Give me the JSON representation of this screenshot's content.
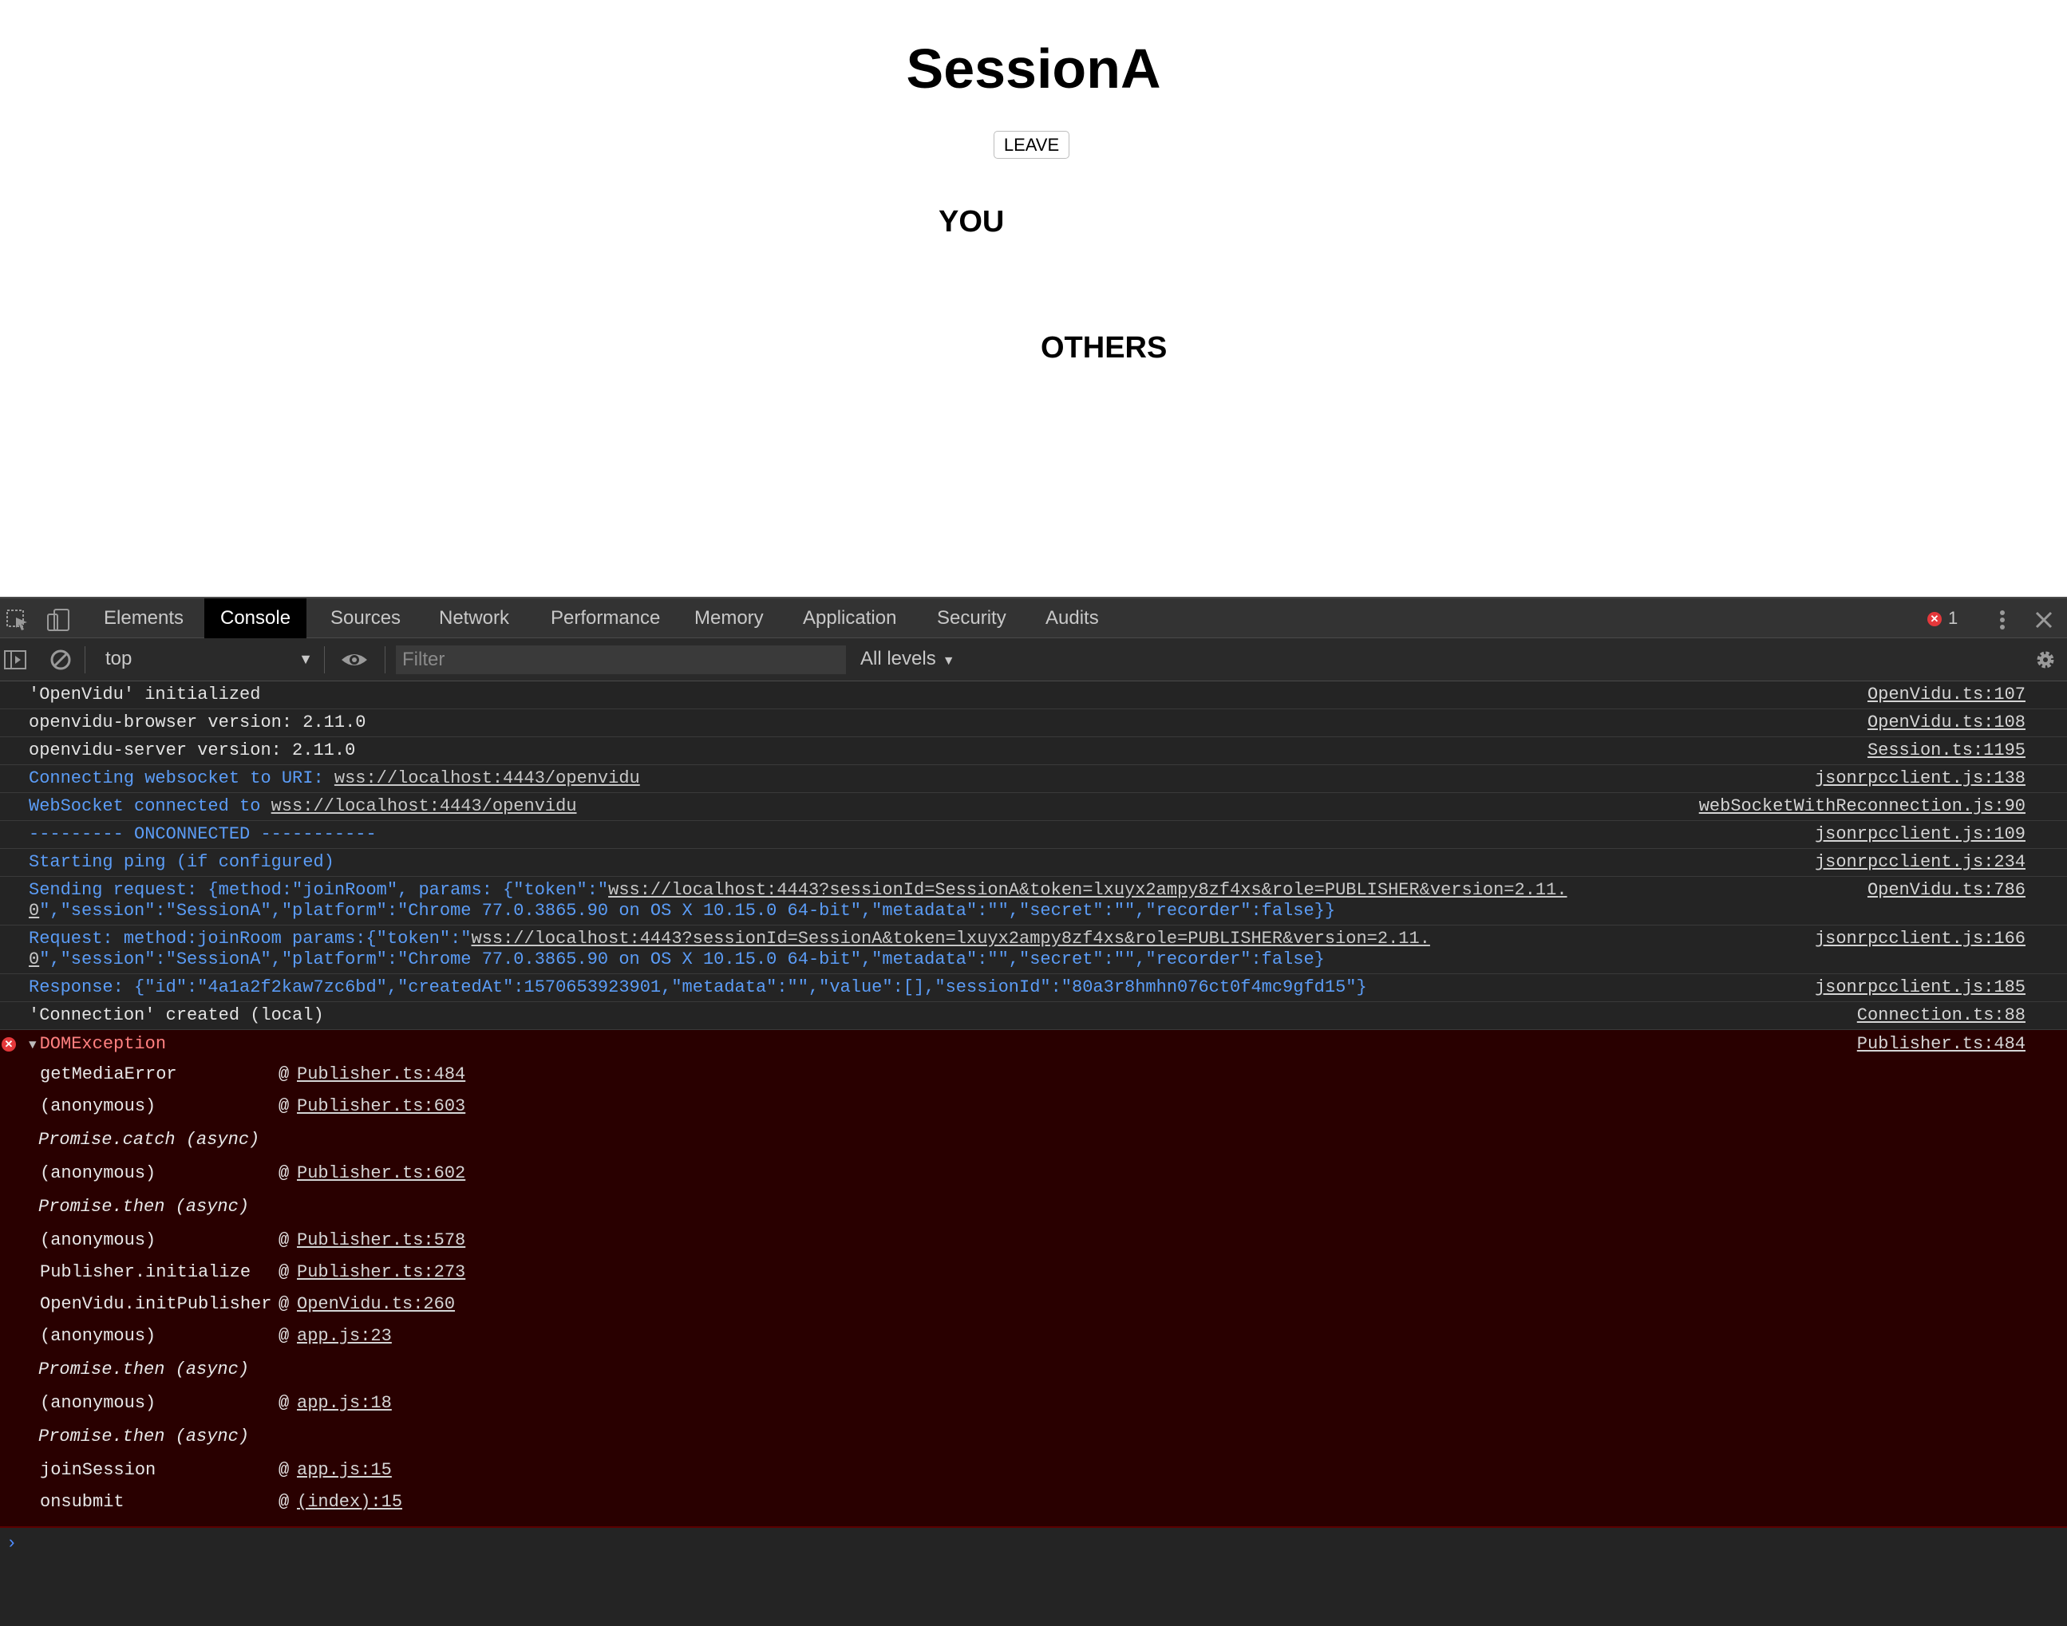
{
  "page": {
    "title": "SessionA",
    "leave_label": "LEAVE",
    "you_heading": "YOU",
    "others_heading": "OTHERS"
  },
  "devtools": {
    "tabs": [
      "Elements",
      "Console",
      "Sources",
      "Network",
      "Performance",
      "Memory",
      "Application",
      "Security",
      "Audits"
    ],
    "active_tab": "Console",
    "error_count": "1",
    "context": "top",
    "filter_placeholder": "Filter",
    "levels": "All levels",
    "messages": [
      {
        "type": "log",
        "text": "'OpenVidu' initialized",
        "source": "OpenVidu.ts:107"
      },
      {
        "type": "log",
        "text": "openvidu-browser version: 2.11.0",
        "source": "OpenVidu.ts:108"
      },
      {
        "type": "log",
        "text": "openvidu-server version: 2.11.0",
        "source": "Session.ts:1195"
      },
      {
        "type": "info",
        "prefix": "Connecting websocket to URI: ",
        "link": "wss://localhost:4443/openvidu",
        "source": "jsonrpcclient.js:138"
      },
      {
        "type": "info",
        "prefix": "WebSocket connected to ",
        "link": "wss://localhost:4443/openvidu",
        "source": "webSocketWithReconnection.js:90"
      },
      {
        "type": "info",
        "text": "--------- ONCONNECTED -----------",
        "source": "jsonrpcclient.js:109"
      },
      {
        "type": "info",
        "text": "Starting ping (if configured)",
        "source": "jsonrpcclient.js:234"
      },
      {
        "type": "info",
        "prefix": "Sending request: {method:\"joinRoom\", params: {\"token\":\"",
        "link": "wss://localhost:4443?sessionId=SessionA&token=lxuyx2ampy8zf4xs&role=PUBLISHER&version=2.11.",
        "line2_link": "0",
        "line2": "\",\"session\":\"SessionA\",\"platform\":\"Chrome 77.0.3865.90 on OS X 10.15.0 64-bit\",\"metadata\":\"\",\"secret\":\"\",\"recorder\":false}}",
        "source": "OpenVidu.ts:786"
      },
      {
        "type": "info",
        "prefix": "Request: method:joinRoom params:{\"token\":\"",
        "link": "wss://localhost:4443?sessionId=SessionA&token=lxuyx2ampy8zf4xs&role=PUBLISHER&version=2.11.",
        "line2_link": "0",
        "line2": "\",\"session\":\"SessionA\",\"platform\":\"Chrome 77.0.3865.90 on OS X 10.15.0 64-bit\",\"metadata\":\"\",\"secret\":\"\",\"recorder\":false}",
        "source": "jsonrpcclient.js:166"
      },
      {
        "type": "info",
        "text": "Response: {\"id\":\"4a1a2f2kaw7zc6bd\",\"createdAt\":1570653923901,\"metadata\":\"\",\"value\":[],\"sessionId\":\"80a3r8hmhn076ct0f4mc9gfd15\"}",
        "source": "jsonrpcclient.js:185"
      },
      {
        "type": "log",
        "text": "'Connection' created (local)",
        "source": "Connection.ts:88"
      }
    ],
    "error": {
      "title": "DOMException",
      "source": "Publisher.ts:484",
      "frames": [
        {
          "fn": "getMediaError",
          "file": "Publisher.ts:484"
        },
        {
          "fn": "(anonymous)",
          "file": "Publisher.ts:603"
        },
        {
          "async": "Promise.catch (async)"
        },
        {
          "fn": "(anonymous)",
          "file": "Publisher.ts:602"
        },
        {
          "async": "Promise.then (async)"
        },
        {
          "fn": "(anonymous)",
          "file": "Publisher.ts:578"
        },
        {
          "fn": "Publisher.initialize",
          "file": "Publisher.ts:273"
        },
        {
          "fn": "OpenVidu.initPublisher",
          "file": "OpenVidu.ts:260"
        },
        {
          "fn": "(anonymous)",
          "file": "app.js:23"
        },
        {
          "async": "Promise.then (async)"
        },
        {
          "fn": "(anonymous)",
          "file": "app.js:18"
        },
        {
          "async": "Promise.then (async)"
        },
        {
          "fn": "joinSession",
          "file": "app.js:15"
        },
        {
          "fn": "onsubmit",
          "file": "(index):15"
        }
      ]
    },
    "prompt_glyph": "›",
    "colors": {
      "error_bg": "#290000",
      "info_text": "#5b9cf6",
      "panel_bg": "#242424"
    }
  }
}
